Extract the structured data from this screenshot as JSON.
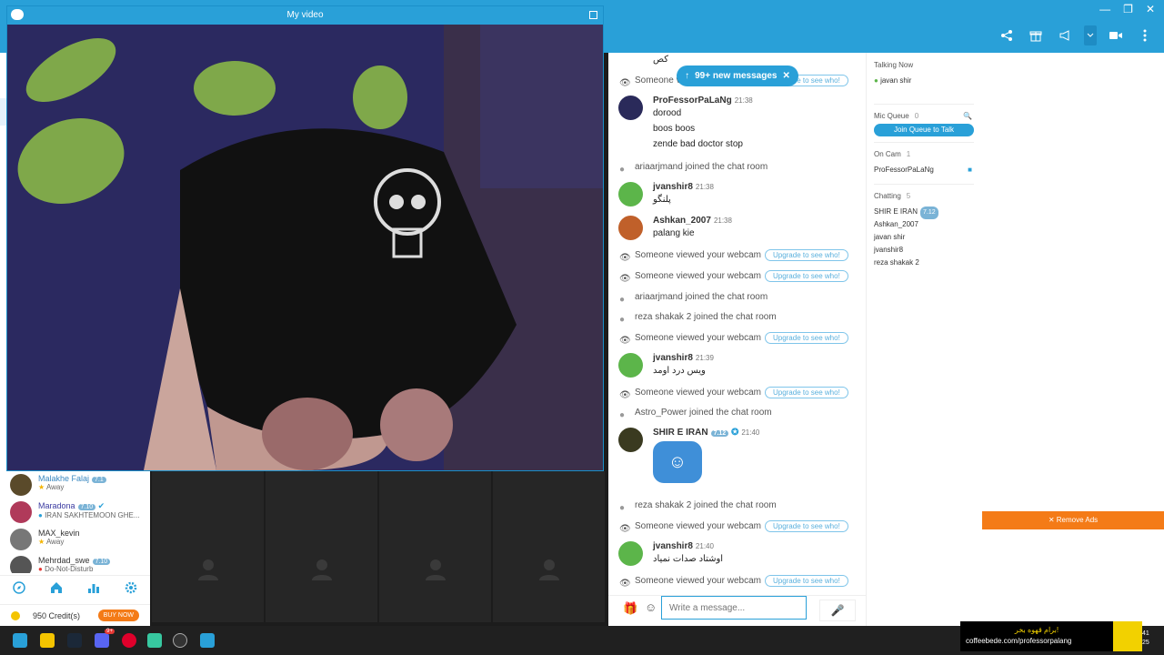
{
  "window": {
    "title": "My video"
  },
  "new_messages_pill": {
    "label": "99+ new messages"
  },
  "chat": {
    "top_partial_text": "کص",
    "upgrade_label": "Upgrade to see who!",
    "input_placeholder": "Write a message...",
    "items": [
      {
        "kind": "view",
        "text": "Someone viewed your webcam"
      },
      {
        "kind": "msg",
        "user": "ProFessorPaLaNg",
        "time": "21:38",
        "lines": [
          "dorood",
          "boos boos",
          "zende bad doctor stop"
        ]
      },
      {
        "kind": "join",
        "text": "ariaarjmand joined the chat room"
      },
      {
        "kind": "msg",
        "user": "jvanshir8",
        "time": "21:38",
        "lines": [
          "پلنگو"
        ]
      },
      {
        "kind": "msg",
        "user": "Ashkan_2007",
        "time": "21:38",
        "lines": [
          "palang kie"
        ]
      },
      {
        "kind": "view",
        "text": "Someone viewed your webcam"
      },
      {
        "kind": "view",
        "text": "Someone viewed your webcam"
      },
      {
        "kind": "join",
        "text": "ariaarjmand joined the chat room"
      },
      {
        "kind": "join",
        "text": "reza shakak 2 joined the chat room"
      },
      {
        "kind": "view",
        "text": "Someone viewed your webcam"
      },
      {
        "kind": "msg",
        "user": "jvanshir8",
        "time": "21:39",
        "lines": [
          "ویس درد اومد"
        ]
      },
      {
        "kind": "view",
        "text": "Someone viewed your webcam"
      },
      {
        "kind": "join",
        "text": "Astro_Power joined the chat room"
      },
      {
        "kind": "msg",
        "user": "SHIR E IRAN",
        "badge": "7.12",
        "time": "21:40",
        "lines": []
      },
      {
        "kind": "join",
        "text": "reza shakak 2 joined the chat room"
      },
      {
        "kind": "view",
        "text": "Someone viewed your webcam"
      },
      {
        "kind": "msg",
        "user": "jvanshir8",
        "time": "21:40",
        "lines": [
          "اوشتاد صدات نمیاد"
        ]
      },
      {
        "kind": "view",
        "text": "Someone viewed your webcam"
      }
    ]
  },
  "side": {
    "talking_now": {
      "title": "Talking Now",
      "user": "javan shir"
    },
    "mic_queue": {
      "title": "Mic Queue",
      "count": "0",
      "button": "Join Queue to Talk"
    },
    "on_cam": {
      "title": "On Cam",
      "count": "1",
      "user": "ProFessorPaLaNg"
    },
    "chatting": {
      "title": "Chatting",
      "count": "5",
      "users": [
        "SHIR E IRAN",
        "Ashkan_2007",
        "javan shir",
        "jvanshir8",
        "reza shakak 2"
      ],
      "first_badge": "7.12"
    }
  },
  "users": [
    {
      "name": "Malakhe Falaj",
      "badge": "7.1",
      "status": "Away"
    },
    {
      "name": "Maradona",
      "badge": "7.10",
      "status": "IRAN SAKHTEMOON GHE..."
    },
    {
      "name": "MAX_kevin",
      "badge": "",
      "status": "Away"
    },
    {
      "name": "Mehrdad_swe",
      "badge": "7.10",
      "status": "Do-Not-Disturb"
    }
  ],
  "credits": {
    "text": "950 Credit(s)",
    "buy": "BUY NOW"
  },
  "ads": {
    "remove": "Remove Ads"
  },
  "promo": {
    "line1": "برام قهوه بخر!",
    "line2": "coffeebede.com/professorpalang"
  },
  "taskbar": {
    "clock1": "41",
    "clock2": "25",
    "discord_badge": "9+"
  },
  "colors": {
    "accent": "#29a0d8",
    "orange": "#f47b17"
  }
}
